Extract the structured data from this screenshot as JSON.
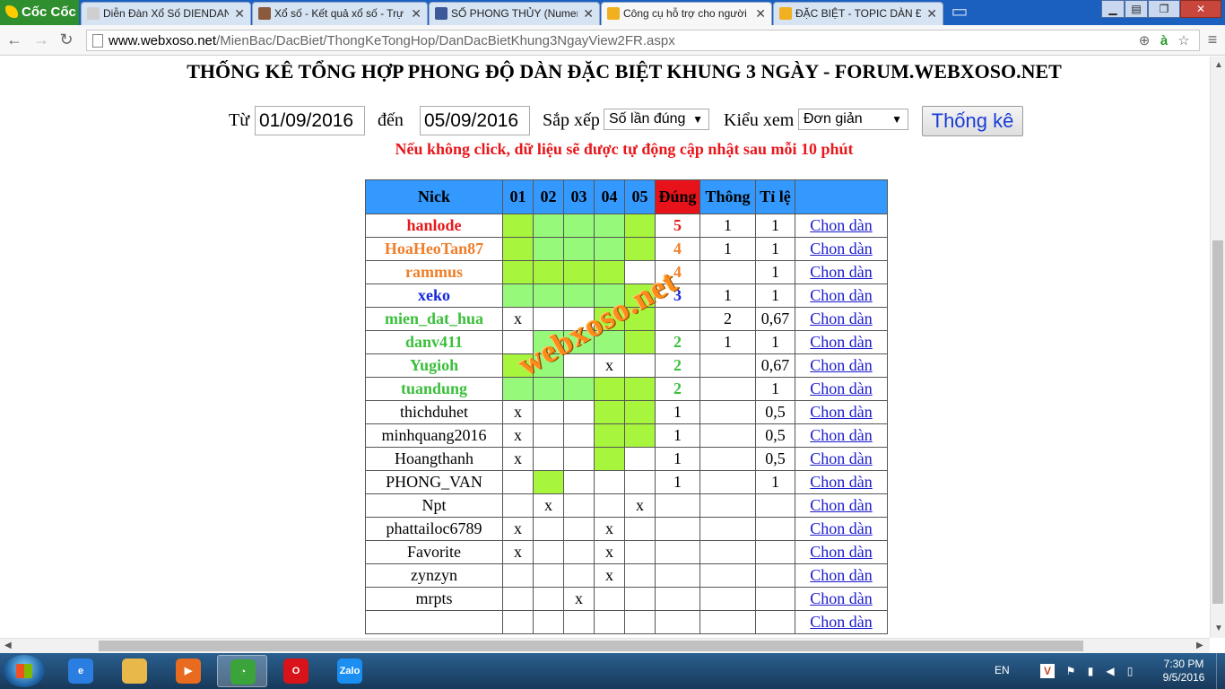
{
  "browser": {
    "logo_text": "Cốc Cốc",
    "tabs": [
      {
        "title": "Diễn Đàn Xổ Số DIENDAN",
        "icon": "page-icon",
        "color": "#cfcfcf"
      },
      {
        "title": "Xổ số - Kết quả xổ số - Trự",
        "icon": "globe-icon",
        "color": "#8a5a3c"
      },
      {
        "title": "SỐ PHONG THỦY (Numer",
        "icon": "facebook-icon",
        "color": "#3b5998"
      },
      {
        "title": "Công cụ hỗ trợ cho người",
        "icon": "xs-icon",
        "color": "#f0b020"
      },
      {
        "title": "ĐẶC BIỆT - TOPIC DÀN ĐẶ",
        "icon": "xs-icon",
        "color": "#f0b020"
      }
    ],
    "active_tab": 3,
    "close_glyph": "✕",
    "url_domain": "www.webxoso.net",
    "url_path": "/MienBac/DacBiet/ThongKeTongHop/DanDacBietKhung3NgayView2FR.aspx"
  },
  "page": {
    "title": "THỐNG KÊ TỔNG HỢP PHONG ĐỘ DÀN ĐẶC BIỆT KHUNG 3 NGÀY - FORUM.WEBXOSO.NET",
    "filter": {
      "from_label": "Từ",
      "from_value": "01/09/2016",
      "to_label": "đến",
      "to_value": "05/09/2016",
      "sort_label": "Sắp xếp",
      "sort_value": "Số lần đúng",
      "view_label": "Kiểu xem",
      "view_value": "Đơn giản",
      "submit_label": "Thống kê"
    },
    "notice": "Nếu không click, dữ liệu sẽ được tự động cập nhật sau mỗi 10 phút",
    "watermark": "webxoso.net",
    "table": {
      "headers": [
        "Nick",
        "01",
        "02",
        "03",
        "04",
        "05",
        "Đúng",
        "Thông",
        "Tỉ lệ",
        ""
      ],
      "link_label": "Chon dàn",
      "rows": [
        {
          "nick": "hanlode",
          "style": "red",
          "days": [
            "g1",
            "g2",
            "g2",
            "g2",
            "g1"
          ],
          "dung": "5",
          "thong": "1",
          "tile": "1"
        },
        {
          "nick": "HoaHeoTan87",
          "style": "orange",
          "days": [
            "g1",
            "g2",
            "g2",
            "g2",
            "g1"
          ],
          "dung": "4",
          "thong": "1",
          "tile": "1"
        },
        {
          "nick": "rammus",
          "style": "orange",
          "days": [
            "g1",
            "g1",
            "g1",
            "g1",
            ""
          ],
          "dung": "4",
          "thong": "",
          "tile": "1"
        },
        {
          "nick": "xeko",
          "style": "blue",
          "days": [
            "g2",
            "g2",
            "g2",
            "g2",
            "g1"
          ],
          "dung": "3",
          "thong": "1",
          "tile": "1"
        },
        {
          "nick": "mien_dat_hua",
          "style": "green",
          "days": [
            "x",
            "",
            "",
            "g1",
            "g1"
          ],
          "dung": "",
          "thong": "2",
          "tile": "0,67"
        },
        {
          "nick": "danv411",
          "style": "green",
          "days": [
            "",
            "g2",
            "g2",
            "g2",
            "g1"
          ],
          "dung": "2",
          "thong": "1",
          "tile": "1"
        },
        {
          "nick": "Yugioh",
          "style": "green",
          "days": [
            "g1",
            "g2",
            "",
            "x",
            ""
          ],
          "dung": "2",
          "thong": "",
          "tile": "0,67"
        },
        {
          "nick": "tuandung",
          "style": "green",
          "days": [
            "g2",
            "g2",
            "g2",
            "g1",
            "g1"
          ],
          "dung": "2",
          "thong": "",
          "tile": "1"
        },
        {
          "nick": "thichduhet",
          "style": "black",
          "days": [
            "x",
            "",
            "",
            "g1",
            "g1"
          ],
          "dung": "1",
          "thong": "",
          "tile": "0,5"
        },
        {
          "nick": "minhquang2016",
          "style": "black",
          "days": [
            "x",
            "",
            "",
            "g1",
            "g1"
          ],
          "dung": "1",
          "thong": "",
          "tile": "0,5"
        },
        {
          "nick": "Hoangthanh",
          "style": "black",
          "days": [
            "x",
            "",
            "",
            "g1",
            ""
          ],
          "dung": "1",
          "thong": "",
          "tile": "0,5"
        },
        {
          "nick": "PHONG_VAN",
          "style": "black",
          "days": [
            "",
            "g1",
            "",
            "",
            ""
          ],
          "dung": "1",
          "thong": "",
          "tile": "1"
        },
        {
          "nick": "Npt",
          "style": "black",
          "days": [
            "",
            "x",
            "",
            "",
            "x"
          ],
          "dung": "",
          "thong": "",
          "tile": ""
        },
        {
          "nick": "phattailoc6789",
          "style": "black",
          "days": [
            "x",
            "",
            "",
            "x",
            ""
          ],
          "dung": "",
          "thong": "",
          "tile": ""
        },
        {
          "nick": "Favorite",
          "style": "black",
          "days": [
            "x",
            "",
            "",
            "x",
            ""
          ],
          "dung": "",
          "thong": "",
          "tile": ""
        },
        {
          "nick": "zynzyn",
          "style": "black",
          "days": [
            "",
            "",
            "",
            "x",
            ""
          ],
          "dung": "",
          "thong": "",
          "tile": ""
        },
        {
          "nick": "mrpts",
          "style": "black",
          "days": [
            "",
            "",
            "x",
            "",
            ""
          ],
          "dung": "",
          "thong": "",
          "tile": ""
        },
        {
          "nick": "",
          "style": "black",
          "days": [
            "",
            "",
            "",
            "",
            ""
          ],
          "dung": "",
          "thong": "",
          "tile": ""
        }
      ]
    }
  },
  "taskbar": {
    "apps": [
      {
        "name": "internet-explorer",
        "icon": "ie-icon",
        "color": "#2a7de1",
        "text": "e"
      },
      {
        "name": "file-explorer",
        "icon": "folder-icon",
        "color": "#e8b84a",
        "text": ""
      },
      {
        "name": "media-player",
        "icon": "media-player-icon",
        "color": "#e86b1f",
        "text": "▶"
      },
      {
        "name": "coccoc-browser",
        "icon": "coccoc-icon",
        "color": "#3aa43a",
        "text": "◔"
      },
      {
        "name": "opera-browser",
        "icon": "opera-icon",
        "color": "#d8141a",
        "text": "O"
      },
      {
        "name": "zalo",
        "icon": "zalo-icon",
        "color": "#1b8ef2",
        "text": "Zalo"
      }
    ],
    "language": "EN",
    "time": "7:30 PM",
    "date": "9/5/2016"
  }
}
